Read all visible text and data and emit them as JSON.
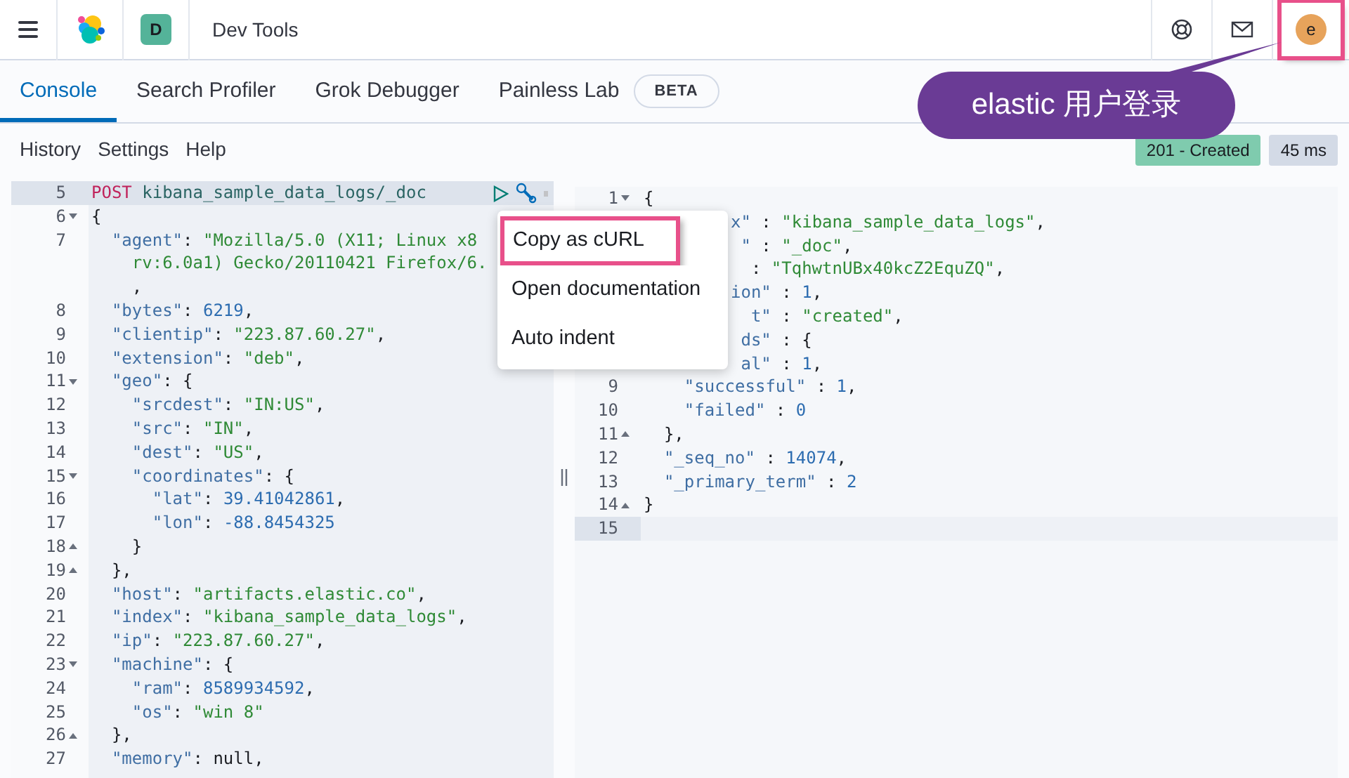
{
  "header": {
    "title": "Dev Tools",
    "space_initial": "D",
    "user_initial": "e",
    "user_highlighted": true
  },
  "callout": "elastic 用户登录",
  "tabs": [
    {
      "label": "Console",
      "selected": true
    },
    {
      "label": "Search Profiler",
      "selected": false
    },
    {
      "label": "Grok Debugger",
      "selected": false
    },
    {
      "label": "Painless Lab",
      "selected": false,
      "badge": "BETA"
    }
  ],
  "console_menu": [
    "History",
    "Settings",
    "Help"
  ],
  "status": {
    "code": "201 - Created",
    "time": "45 ms"
  },
  "request_lines": [
    {
      "num": "5",
      "kind": "plain",
      "selected": true,
      "tokens": [
        {
          "kind": "method",
          "text": "POST"
        },
        {
          "kind": "url",
          "text": " kibana_sample_data_logs/_doc"
        }
      ]
    },
    {
      "num": "6",
      "kind": "fold_open",
      "selected": false,
      "tokens": [
        {
          "kind": "punct",
          "text": "{"
        }
      ]
    },
    {
      "num": "7",
      "kind": "plain",
      "selected": false,
      "tokens": [
        {
          "kind": "key",
          "text": "  \"agent\""
        },
        {
          "kind": "punct",
          "text": ": "
        },
        {
          "kind": "string",
          "text": "\"Mozilla/5.0 (X11; Linux x8"
        }
      ]
    },
    {
      "kind": "wrap",
      "selected": false,
      "tokens": [
        {
          "kind": "string",
          "text": "    rv:6.0a1) Gecko/20110421 Firefox/6."
        }
      ]
    },
    {
      "kind": "wrap",
      "selected": false,
      "tokens": [
        {
          "kind": "punct",
          "text": "    ,"
        }
      ]
    },
    {
      "num": "8",
      "kind": "plain",
      "selected": false,
      "tokens": [
        {
          "kind": "key",
          "text": "  \"bytes\""
        },
        {
          "kind": "punct",
          "text": ": "
        },
        {
          "kind": "number",
          "text": "6219"
        },
        {
          "kind": "punct",
          "text": ","
        }
      ]
    },
    {
      "num": "9",
      "kind": "plain",
      "selected": false,
      "tokens": [
        {
          "kind": "key",
          "text": "  \"clientip\""
        },
        {
          "kind": "punct",
          "text": ": "
        },
        {
          "kind": "string",
          "text": "\"223.87.60.27\""
        },
        {
          "kind": "punct",
          "text": ","
        }
      ]
    },
    {
      "num": "10",
      "kind": "plain",
      "selected": false,
      "tokens": [
        {
          "kind": "key",
          "text": "  \"extension\""
        },
        {
          "kind": "punct",
          "text": ": "
        },
        {
          "kind": "string",
          "text": "\"deb\""
        },
        {
          "kind": "punct",
          "text": ","
        }
      ]
    },
    {
      "num": "11",
      "kind": "fold_open",
      "selected": false,
      "tokens": [
        {
          "kind": "key",
          "text": "  \"geo\""
        },
        {
          "kind": "punct",
          "text": ": {"
        }
      ]
    },
    {
      "num": "12",
      "kind": "plain",
      "selected": false,
      "tokens": [
        {
          "kind": "key",
          "text": "    \"srcdest\""
        },
        {
          "kind": "punct",
          "text": ": "
        },
        {
          "kind": "string",
          "text": "\"IN:US\""
        },
        {
          "kind": "punct",
          "text": ","
        }
      ]
    },
    {
      "num": "13",
      "kind": "plain",
      "selected": false,
      "tokens": [
        {
          "kind": "key",
          "text": "    \"src\""
        },
        {
          "kind": "punct",
          "text": ": "
        },
        {
          "kind": "string",
          "text": "\"IN\""
        },
        {
          "kind": "punct",
          "text": ","
        }
      ]
    },
    {
      "num": "14",
      "kind": "plain",
      "selected": false,
      "tokens": [
        {
          "kind": "key",
          "text": "    \"dest\""
        },
        {
          "kind": "punct",
          "text": ": "
        },
        {
          "kind": "string",
          "text": "\"US\""
        },
        {
          "kind": "punct",
          "text": ","
        }
      ]
    },
    {
      "num": "15",
      "kind": "fold_open",
      "selected": false,
      "tokens": [
        {
          "kind": "key",
          "text": "    \"coordinates\""
        },
        {
          "kind": "punct",
          "text": ": {"
        }
      ]
    },
    {
      "num": "16",
      "kind": "plain",
      "selected": false,
      "tokens": [
        {
          "kind": "key",
          "text": "      \"lat\""
        },
        {
          "kind": "punct",
          "text": ": "
        },
        {
          "kind": "number",
          "text": "39.41042861"
        },
        {
          "kind": "punct",
          "text": ","
        }
      ]
    },
    {
      "num": "17",
      "kind": "plain",
      "selected": false,
      "tokens": [
        {
          "kind": "key",
          "text": "      \"lon\""
        },
        {
          "kind": "punct",
          "text": ": "
        },
        {
          "kind": "number",
          "text": "-88.8454325"
        }
      ]
    },
    {
      "num": "18",
      "kind": "fold_close",
      "selected": false,
      "tokens": [
        {
          "kind": "punct",
          "text": "    }"
        }
      ]
    },
    {
      "num": "19",
      "kind": "fold_close",
      "selected": false,
      "tokens": [
        {
          "kind": "punct",
          "text": "  },"
        }
      ]
    },
    {
      "num": "20",
      "kind": "plain",
      "selected": false,
      "tokens": [
        {
          "kind": "key",
          "text": "  \"host\""
        },
        {
          "kind": "punct",
          "text": ": "
        },
        {
          "kind": "string",
          "text": "\"artifacts.elastic.co\""
        },
        {
          "kind": "punct",
          "text": ","
        }
      ]
    },
    {
      "num": "21",
      "kind": "plain",
      "selected": false,
      "tokens": [
        {
          "kind": "key",
          "text": "  \"index\""
        },
        {
          "kind": "punct",
          "text": ": "
        },
        {
          "kind": "string",
          "text": "\"kibana_sample_data_logs\""
        },
        {
          "kind": "punct",
          "text": ","
        }
      ]
    },
    {
      "num": "22",
      "kind": "plain",
      "selected": false,
      "tokens": [
        {
          "kind": "key",
          "text": "  \"ip\""
        },
        {
          "kind": "punct",
          "text": ": "
        },
        {
          "kind": "string",
          "text": "\"223.87.60.27\""
        },
        {
          "kind": "punct",
          "text": ","
        }
      ]
    },
    {
      "num": "23",
      "kind": "fold_open",
      "selected": false,
      "tokens": [
        {
          "kind": "key",
          "text": "  \"machine\""
        },
        {
          "kind": "punct",
          "text": ": {"
        }
      ]
    },
    {
      "num": "24",
      "kind": "plain",
      "selected": false,
      "tokens": [
        {
          "kind": "key",
          "text": "    \"ram\""
        },
        {
          "kind": "punct",
          "text": ": "
        },
        {
          "kind": "number",
          "text": "8589934592"
        },
        {
          "kind": "punct",
          "text": ","
        }
      ]
    },
    {
      "num": "25",
      "kind": "plain",
      "selected": false,
      "tokens": [
        {
          "kind": "key",
          "text": "    \"os\""
        },
        {
          "kind": "punct",
          "text": ": "
        },
        {
          "kind": "string",
          "text": "\"win 8\""
        }
      ]
    },
    {
      "num": "26",
      "kind": "fold_close",
      "selected": false,
      "tokens": [
        {
          "kind": "punct",
          "text": "  },"
        }
      ]
    },
    {
      "num": "27",
      "kind": "plain",
      "selected": false,
      "tokens": [
        {
          "kind": "key",
          "text": "  \"memory\""
        },
        {
          "kind": "punct",
          "text": ": "
        },
        {
          "kind": "punct",
          "text": "null,"
        }
      ]
    }
  ],
  "context_menu": [
    {
      "label": "Copy as cURL",
      "highlighted": true
    },
    {
      "label": "Open documentation",
      "highlighted": false
    },
    {
      "label": "Auto indent",
      "highlighted": false
    }
  ],
  "response_lines": [
    {
      "num": "1",
      "kind": "fold_open",
      "selected": false,
      "tokens": [
        {
          "kind": "punct",
          "text": "{"
        }
      ]
    },
    {
      "kind": "covered",
      "tokens": [
        {
          "kind": "key",
          "text": "x\""
        },
        {
          "kind": "punct",
          "text": " : "
        },
        {
          "kind": "string",
          "text": "\"kibana_sample_data_logs\""
        },
        {
          "kind": "punct",
          "text": ","
        }
      ]
    },
    {
      "kind": "covered",
      "tokens": [
        {
          "kind": "key",
          "text": " \""
        },
        {
          "kind": "punct",
          "text": " : "
        },
        {
          "kind": "string",
          "text": "\"_doc\""
        },
        {
          "kind": "punct",
          "text": ","
        }
      ]
    },
    {
      "kind": "covered",
      "tokens": [
        {
          "kind": "punct",
          "text": "  : "
        },
        {
          "kind": "string",
          "text": "\"TqhwtnUBx40kcZ2EquZQ\""
        },
        {
          "kind": "punct",
          "text": ","
        }
      ]
    },
    {
      "kind": "covered",
      "tokens": [
        {
          "kind": "key",
          "text": "ion\""
        },
        {
          "kind": "punct",
          "text": " : "
        },
        {
          "kind": "number",
          "text": "1"
        },
        {
          "kind": "punct",
          "text": ","
        }
      ]
    },
    {
      "kind": "covered",
      "tokens": [
        {
          "kind": "key",
          "text": "  t\""
        },
        {
          "kind": "punct",
          "text": " : "
        },
        {
          "kind": "string",
          "text": "\"created\""
        },
        {
          "kind": "punct",
          "text": ","
        }
      ]
    },
    {
      "kind": "covered",
      "tokens": [
        {
          "kind": "key",
          "text": " ds\""
        },
        {
          "kind": "punct",
          "text": " : {"
        }
      ]
    },
    {
      "kind": "covered",
      "tokens": [
        {
          "kind": "key",
          "text": " al\""
        },
        {
          "kind": "punct",
          "text": " : "
        },
        {
          "kind": "number",
          "text": "1"
        },
        {
          "kind": "punct",
          "text": ","
        }
      ]
    },
    {
      "num": "9",
      "kind": "plain",
      "selected": false,
      "tokens": [
        {
          "kind": "key",
          "text": "    \"successful\""
        },
        {
          "kind": "punct",
          "text": " : "
        },
        {
          "kind": "number",
          "text": "1"
        },
        {
          "kind": "punct",
          "text": ","
        }
      ]
    },
    {
      "num": "10",
      "kind": "plain",
      "selected": false,
      "tokens": [
        {
          "kind": "key",
          "text": "    \"failed\""
        },
        {
          "kind": "punct",
          "text": " : "
        },
        {
          "kind": "number",
          "text": "0"
        }
      ]
    },
    {
      "num": "11",
      "kind": "fold_close",
      "selected": false,
      "tokens": [
        {
          "kind": "punct",
          "text": "  },"
        }
      ]
    },
    {
      "num": "12",
      "kind": "plain",
      "selected": false,
      "tokens": [
        {
          "kind": "key",
          "text": "  \"_seq_no\""
        },
        {
          "kind": "punct",
          "text": " : "
        },
        {
          "kind": "number",
          "text": "14074"
        },
        {
          "kind": "punct",
          "text": ","
        }
      ]
    },
    {
      "num": "13",
      "kind": "plain",
      "selected": false,
      "tokens": [
        {
          "kind": "key",
          "text": "  \"_primary_term\""
        },
        {
          "kind": "punct",
          "text": " : "
        },
        {
          "kind": "number",
          "text": "2"
        }
      ]
    },
    {
      "num": "14",
      "kind": "fold_close",
      "selected": false,
      "tokens": [
        {
          "kind": "punct",
          "text": "}"
        }
      ]
    },
    {
      "num": "15",
      "kind": "plain",
      "selected": true
    }
  ]
}
